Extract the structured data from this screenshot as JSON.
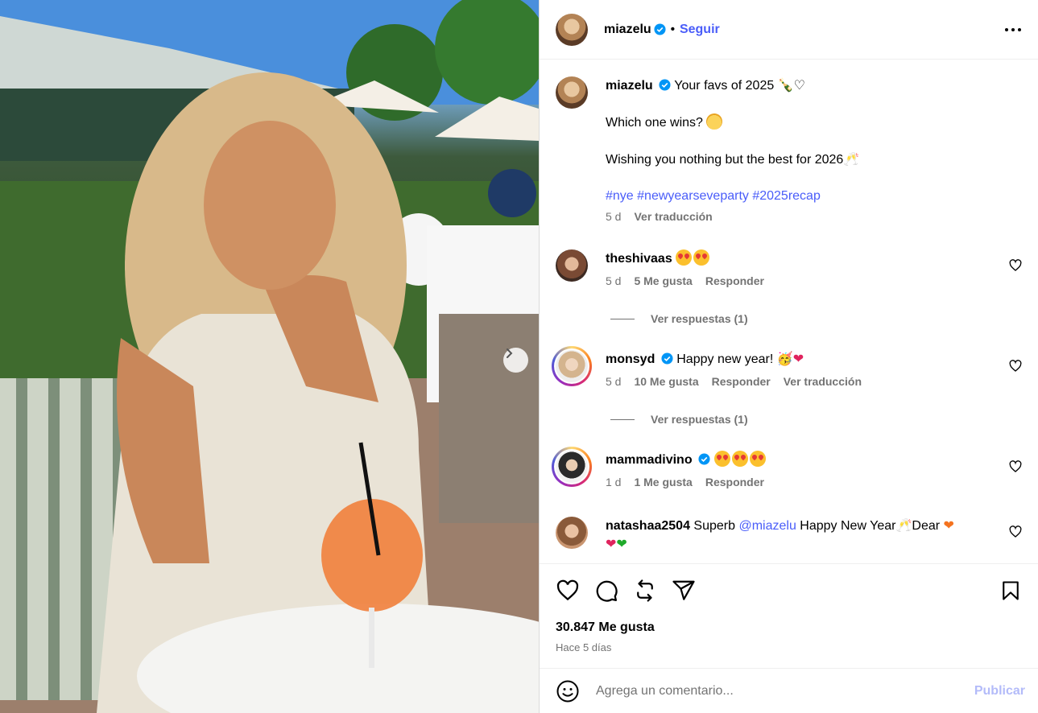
{
  "post": {
    "username": "miazelu",
    "follow_label": "Seguir",
    "dot": "•",
    "caption_line1": "Your favs of 2025",
    "caption_line2": "Which one wins?",
    "caption_line3": "Wishing you nothing but the best for 2026",
    "hashtags": "#nye #newyearseveparty #2025recap",
    "caption_age": "5 d",
    "translate_label": "Ver traducción",
    "likes": "30.847 Me gusta",
    "posted": "Hace 5 días",
    "add_comment_placeholder": "Agrega un comentario...",
    "publish_label": "Publicar",
    "photo_description_icon": "carousel-next-icon"
  },
  "comments": [
    {
      "username": "theshivaas",
      "text": "",
      "age": "5 d",
      "likes": "5 Me gusta",
      "reply": "Responder",
      "view_replies": "Ver respuestas (1)"
    },
    {
      "username": "monsyd",
      "text": "Happy new year!",
      "age": "5 d",
      "likes": "10 Me gusta",
      "reply": "Responder",
      "translate": "Ver traducción",
      "view_replies": "Ver respuestas (1)"
    },
    {
      "username": "mammadivino",
      "text": "",
      "age": "1 d",
      "likes": "1 Me gusta",
      "reply": "Responder"
    },
    {
      "username": "natashaa2504",
      "text_before": "Superb",
      "mention": "@miazelu",
      "text_after": "Happy New Year",
      "text_end": "Dear"
    }
  ],
  "colors": {
    "link": "#4a5df9",
    "verified": "#0095f6",
    "muted": "#737373",
    "publish_disabled": "#b3bbf9"
  }
}
